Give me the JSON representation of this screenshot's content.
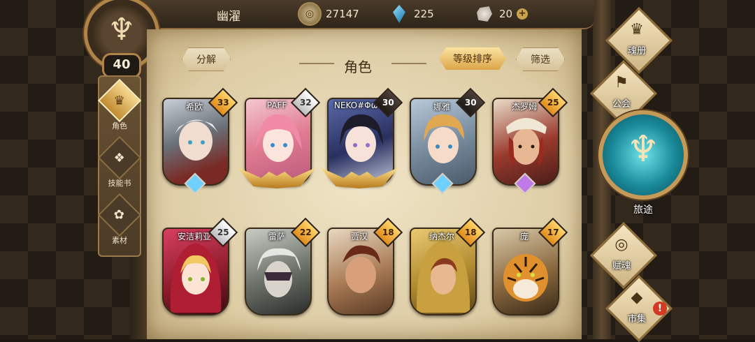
{
  "header": {
    "player_name": "幽濯",
    "gold": "27147",
    "crystals": "225",
    "stones": "20",
    "plus_symbol": "+"
  },
  "level": "40",
  "side_tabs": [
    {
      "label": "角色",
      "icon": "helmet-icon",
      "glyph": "♛"
    },
    {
      "label": "技能书",
      "icon": "skill-book-icon",
      "glyph": "❖"
    },
    {
      "label": "素材",
      "icon": "material-icon",
      "glyph": "✿"
    }
  ],
  "panel": {
    "decompose_label": "分解",
    "title": "角色",
    "sort_label": "等级排序",
    "filter_label": "筛选"
  },
  "characters": [
    {
      "name": "希欧",
      "level": "33",
      "badge": "gold",
      "base": "gem-blue"
    },
    {
      "name": "PAFF",
      "level": "32",
      "badge": "silver",
      "base": "wings-gold"
    },
    {
      "name": "NEKO#ΦωΦ",
      "level": "30",
      "badge": "dark",
      "base": "wings-gold"
    },
    {
      "name": "娜雅",
      "level": "30",
      "badge": "dark",
      "base": "gem-blue"
    },
    {
      "name": "杰罗姆",
      "level": "25",
      "badge": "gold",
      "base": "gem-purple"
    },
    {
      "name": "安洁莉亚",
      "level": "25",
      "badge": "silver",
      "base": "none"
    },
    {
      "name": "雷萨",
      "level": "22",
      "badge": "gold",
      "base": "none"
    },
    {
      "name": "贾汉",
      "level": "18",
      "badge": "gold",
      "base": "none"
    },
    {
      "name": "纳杰尔",
      "level": "18",
      "badge": "gold",
      "base": "none"
    },
    {
      "name": "庞",
      "level": "17",
      "badge": "gold",
      "base": "none"
    }
  ],
  "right_menu": {
    "soul_book": "魂册",
    "guild": "公会",
    "journey": "旅途",
    "endow_soul": "赋魂",
    "market": "市集",
    "alert_symbol": "!"
  },
  "colors": {
    "accent_gold": "#dca548",
    "parchment": "#efe4c6",
    "journey_teal": "#1a8a9a"
  }
}
